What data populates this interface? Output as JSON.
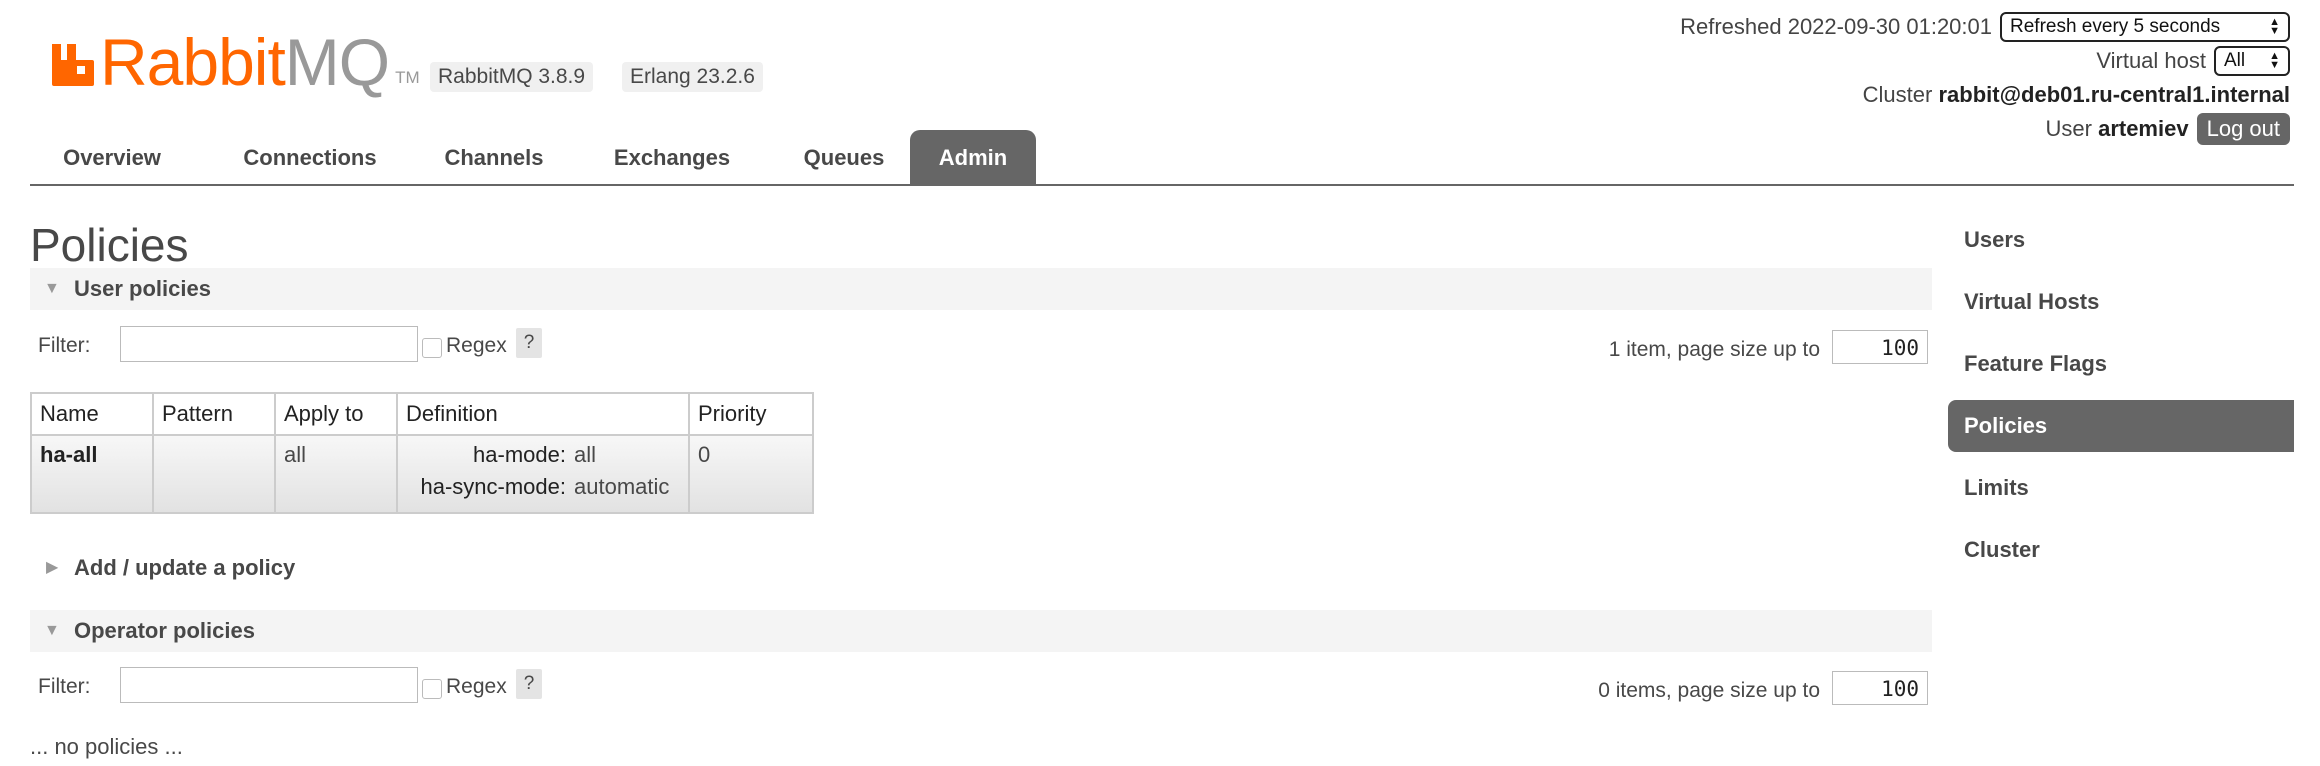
{
  "header": {
    "logo_word_rabbit": "Rabbit",
    "logo_word_mq": "MQ",
    "logo_tm": "TM",
    "rabbitmq_version": "RabbitMQ 3.8.9",
    "erlang_version": "Erlang 23.2.6",
    "refreshed_label": "Refreshed 2022-09-30 01:20:01",
    "refresh_select": "Refresh every 5 seconds",
    "vhost_label": "Virtual host",
    "vhost_select": "All",
    "cluster_label": "Cluster",
    "cluster_name": "rabbit@deb01.ru-central1.internal",
    "user_label": "User",
    "user_name": "artemiev",
    "logout_label": "Log out"
  },
  "tabs": [
    {
      "label": "Overview"
    },
    {
      "label": "Connections"
    },
    {
      "label": "Channels"
    },
    {
      "label": "Exchanges"
    },
    {
      "label": "Queues"
    },
    {
      "label": "Admin",
      "active": true
    }
  ],
  "page_title": "Policies",
  "user_policies": {
    "heading": "User policies",
    "filter_label": "Filter:",
    "filter_value": "",
    "regex_label": "Regex",
    "help_label": "?",
    "paging_text": "1 item, page size up to",
    "page_size": "100",
    "columns": [
      "Name",
      "Pattern",
      "Apply to",
      "Definition",
      "Priority"
    ],
    "rows": [
      {
        "name": "ha-all",
        "pattern": "",
        "apply_to": "all",
        "definition": [
          {
            "key": "ha-mode:",
            "value": "all"
          },
          {
            "key": "ha-sync-mode:",
            "value": "automatic"
          }
        ],
        "priority": "0"
      }
    ]
  },
  "add_policy": {
    "heading": "Add / update a policy"
  },
  "operator_policies": {
    "heading": "Operator policies",
    "filter_label": "Filter:",
    "filter_value": "",
    "regex_label": "Regex",
    "help_label": "?",
    "paging_text": "0 items, page size up to",
    "page_size": "100",
    "empty_text": "... no policies ..."
  },
  "sidebar": {
    "items": [
      {
        "label": "Users"
      },
      {
        "label": "Virtual Hosts"
      },
      {
        "label": "Feature Flags"
      },
      {
        "label": "Policies",
        "active": true
      },
      {
        "label": "Limits"
      },
      {
        "label": "Cluster"
      }
    ]
  },
  "colors": {
    "brand_orange": "#ff6600",
    "tab_active_bg": "#666666",
    "text": "#484848"
  },
  "icons": {
    "logo": "rabbitmq-logo-icon",
    "section_expanded": "triangle-down-icon",
    "section_collapsed": "triangle-right-icon",
    "select_arrows": "up-down-arrows-icon"
  }
}
